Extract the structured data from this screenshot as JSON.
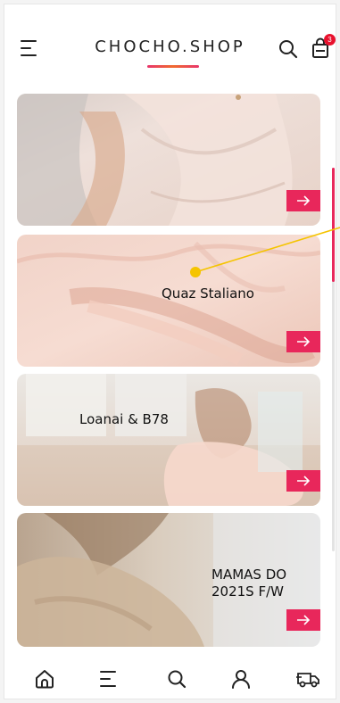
{
  "header": {
    "brand": "CHOCHO.SHOP",
    "cart_count": "3"
  },
  "cards": [
    {
      "label": ""
    },
    {
      "label": "Quaz Staliano"
    },
    {
      "label": "Loanai & B78"
    },
    {
      "label_line1": "MAMAS DO",
      "label_line2": "2021S F/W"
    }
  ],
  "colors": {
    "accent": "#e8275b",
    "badge": "#e8112d",
    "annotation": "#f5c400"
  },
  "icons": {
    "menu": "hamburger-icon",
    "search": "search-icon",
    "cart": "shopping-bag-icon",
    "card_arrow": "arrow-right-icon",
    "nav_home": "home-icon",
    "nav_menu": "menu-icon",
    "nav_search": "search-icon",
    "nav_profile": "user-icon",
    "nav_delivery": "delivery-truck-icon"
  },
  "scroll": {
    "position_fraction": 0.0,
    "visible_fraction": 0.3
  }
}
